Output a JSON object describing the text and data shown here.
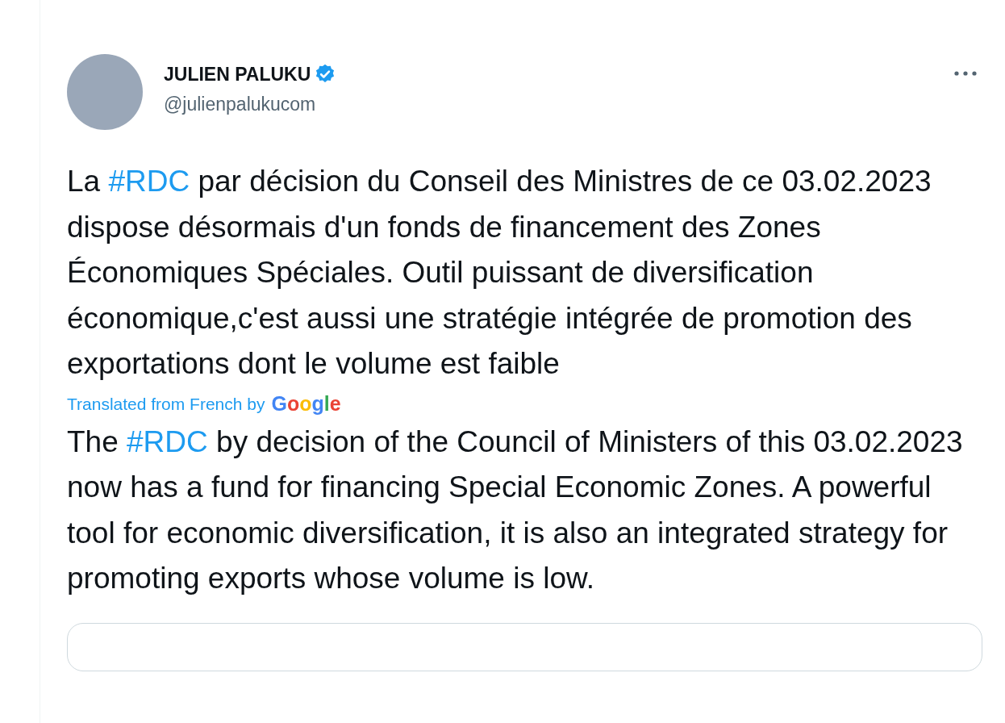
{
  "tweet": {
    "author": {
      "name": "JULIEN PALUKU",
      "verified": true,
      "handle": "@julienpalukucom"
    },
    "original": [
      {
        "kind": "text",
        "text": "La "
      },
      {
        "kind": "hashtag",
        "text": "#RDC"
      },
      {
        "kind": "text",
        "text": " par décision du Conseil des Ministres de ce 03.02.2023 dispose désormais d'un fonds de financement des Zones Économiques Spéciales. Outil puissant de diversification économique,c'est aussi une stratégie intégrée de promotion des exportations dont le volume est faible"
      }
    ],
    "translation_note": {
      "label": "Translated from French by",
      "provider": "Google"
    },
    "translated": [
      {
        "kind": "text",
        "text": "The "
      },
      {
        "kind": "hashtag",
        "text": "#RDC"
      },
      {
        "kind": "text",
        "text": " by decision of the Council of Ministers of this 03.02.2023 now has a fund for financing Special Economic Zones. A powerful tool for economic diversification, it is also an integrated strategy for promoting exports whose volume is low."
      }
    ]
  }
}
